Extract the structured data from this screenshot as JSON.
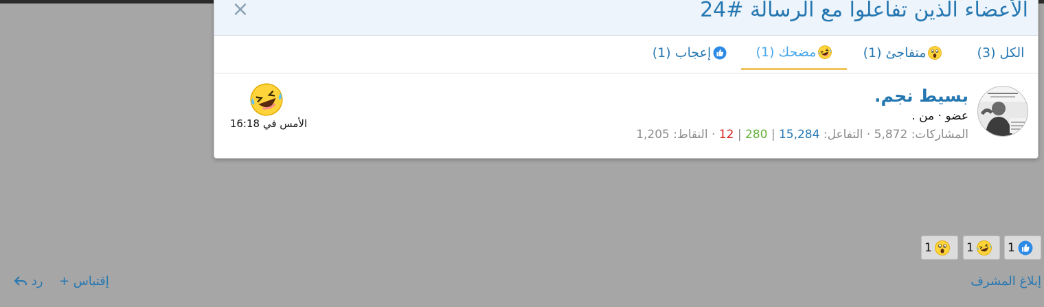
{
  "modal": {
    "title": "الأعضاء الذين تفاعلوا مع الرسالة #24",
    "close_glyph": "×"
  },
  "tabs": [
    {
      "label": "الكل (3)",
      "icon": null,
      "active": false
    },
    {
      "label": "متفاجئ (1)",
      "icon": "wow-emoji-icon",
      "active": false
    },
    {
      "label": "مضحك (1)",
      "icon": "haha-emoji-icon",
      "active": true
    },
    {
      "label": "إعجاب (1)",
      "icon": "like-thumbs-up-icon",
      "active": false
    }
  ],
  "member": {
    "name": "بسيط نجم.",
    "info": "عضو · من .",
    "stats": {
      "posts_label": "المشاركات:",
      "posts": "5,872",
      "sep1": "·",
      "reactions_label": "التفاعل:",
      "reactions": "15,284",
      "bar1": "|",
      "positive": "280",
      "bar2": "|",
      "negative": "12",
      "sep2": "·",
      "points_label": "النقاط:",
      "points": "1,205"
    },
    "reaction_time": "الأمس في 16:18",
    "reaction_icon": "haha-emoji-icon"
  },
  "summary_chips": [
    {
      "count": "1",
      "icon": "like-thumbs-up-icon"
    },
    {
      "count": "1",
      "icon": "haha-emoji-icon"
    },
    {
      "count": "1",
      "icon": "wow-emoji-icon"
    }
  ],
  "footer": {
    "report_label": "إبلاغ المشرف",
    "quote_label": "إقتباس",
    "quote_icon": "plus-icon",
    "reply_label": "رد",
    "reply_icon": "reply-arrow-icon"
  },
  "colors": {
    "accent": "#2577b1",
    "active_tab_underline": "#f0c35c",
    "positive": "#63b03a",
    "negative": "#d61f1f"
  }
}
